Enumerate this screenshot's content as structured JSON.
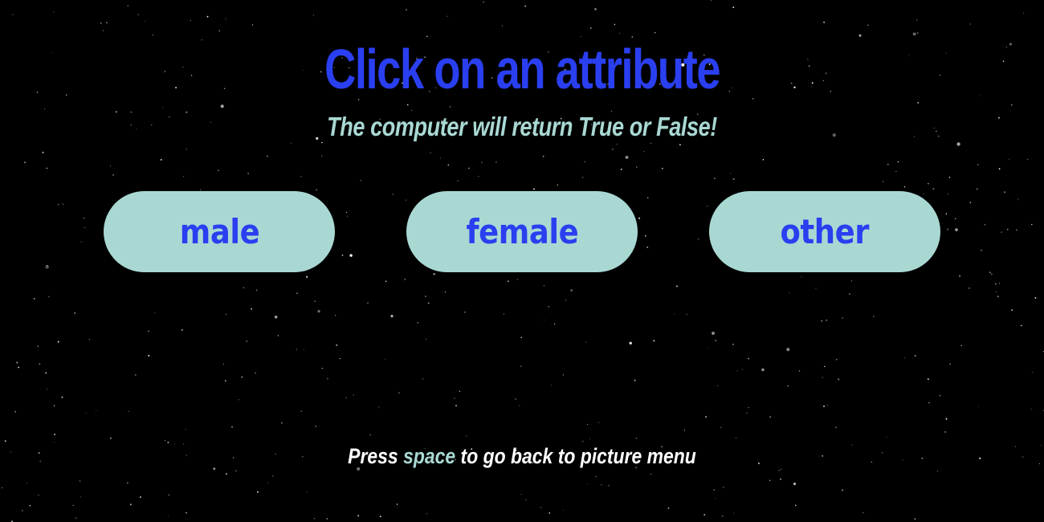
{
  "header": {
    "title": "Click on an attribute",
    "subtitle": "The computer will return True or False!"
  },
  "buttons": [
    {
      "label": "male"
    },
    {
      "label": "female"
    },
    {
      "label": "other"
    }
  ],
  "footer": {
    "prefix": "Press",
    "key": "space",
    "suffix": "to go back to picture menu"
  },
  "colors": {
    "background": "#000000",
    "title": "#2a3ff0",
    "subtitle": "#a9d8d3",
    "button_fill": "#a9d8d3",
    "button_text": "#2a3ff0",
    "footer_text": "#ffffff",
    "footer_key": "#a9d8d3",
    "stars": "#ffffff"
  }
}
